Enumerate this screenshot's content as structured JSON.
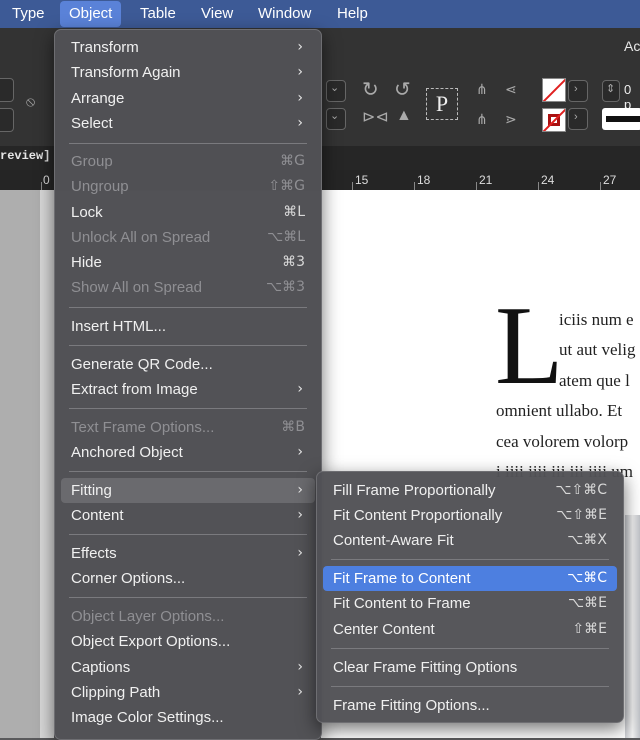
{
  "menubar": {
    "items": [
      "Type",
      "Object",
      "Table",
      "View",
      "Window",
      "Help"
    ],
    "active": "Object"
  },
  "control_panel": {
    "top_right_text": "Ac",
    "field_value": "0 p",
    "frame_icon_letter": "P"
  },
  "document_tab": {
    "label": "review]"
  },
  "ruler": {
    "labels": [
      "0",
      "15",
      "18",
      "21",
      "24",
      "27"
    ]
  },
  "page_text": {
    "drop_cap": "L",
    "lines": [
      "iciis num e",
      "ut aut velig",
      "atem que l",
      "omnient ullabo. Et",
      "cea volorem volorp",
      "i iiii iiii iii iii iiii um"
    ]
  },
  "object_menu": [
    {
      "label": "Transform",
      "submenu": true
    },
    {
      "label": "Transform Again",
      "submenu": true
    },
    {
      "label": "Arrange",
      "submenu": true
    },
    {
      "label": "Select",
      "submenu": true
    },
    {
      "label": "Group",
      "shortcut": "⌘G",
      "disabled": true
    },
    {
      "label": "Ungroup",
      "shortcut": "⇧⌘G",
      "disabled": true
    },
    {
      "label": "Lock",
      "shortcut": "⌘L"
    },
    {
      "label": "Unlock All on Spread",
      "shortcut": "⌥⌘L",
      "disabled": true
    },
    {
      "label": "Hide",
      "shortcut": "⌘3"
    },
    {
      "label": "Show All on Spread",
      "shortcut": "⌥⌘3",
      "disabled": true
    },
    {
      "label": "Insert HTML..."
    },
    {
      "label": "Generate QR Code..."
    },
    {
      "label": "Extract from Image",
      "submenu": true
    },
    {
      "label": "Text Frame Options...",
      "shortcut": "⌘B",
      "disabled": true
    },
    {
      "label": "Anchored Object",
      "submenu": true
    },
    {
      "label": "Fitting",
      "submenu": true,
      "highlighted": true
    },
    {
      "label": "Content",
      "submenu": true
    },
    {
      "label": "Effects",
      "submenu": true
    },
    {
      "label": "Corner Options..."
    },
    {
      "label": "Object Layer Options...",
      "disabled": true
    },
    {
      "label": "Object Export Options..."
    },
    {
      "label": "Captions",
      "submenu": true
    },
    {
      "label": "Clipping Path",
      "submenu": true
    },
    {
      "label": "Image Color Settings..."
    }
  ],
  "fitting_submenu": [
    {
      "label": "Fill Frame Proportionally",
      "shortcut": "⌥⇧⌘C"
    },
    {
      "label": "Fit Content Proportionally",
      "shortcut": "⌥⇧⌘E"
    },
    {
      "label": "Content-Aware Fit",
      "shortcut": "⌥⌘X"
    },
    {
      "label": "Fit Frame to Content",
      "shortcut": "⌥⌘C",
      "selected": true
    },
    {
      "label": "Fit Content to Frame",
      "shortcut": "⌥⌘E"
    },
    {
      "label": "Center Content",
      "shortcut": "⇧⌘E"
    },
    {
      "label": "Clear Frame Fitting Options"
    },
    {
      "label": "Frame Fitting Options..."
    }
  ],
  "colors": {
    "menubar": "#3d5a96",
    "highlight": "#4d7fe0",
    "menu_bg": "#525256"
  }
}
